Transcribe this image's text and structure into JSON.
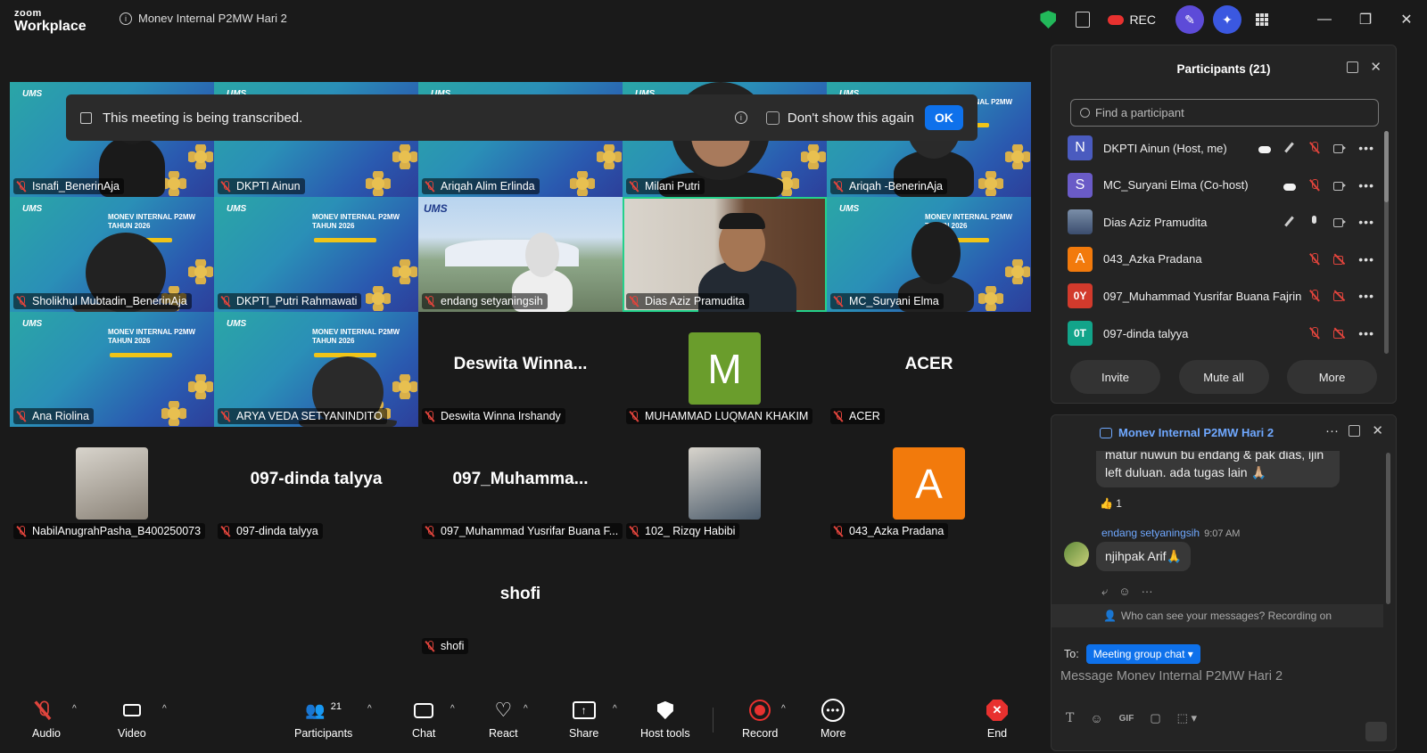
{
  "app": {
    "logo_top": "zoom",
    "logo_bottom": "Workplace",
    "meeting_title": "Monev Internal P2MW Hari 2",
    "rec_label": "REC"
  },
  "banner": {
    "text": "This meeting is being transcribed.",
    "dont_show": "Don't show this again",
    "ok": "OK"
  },
  "tiles": [
    {
      "name": "Isnafi_BenerinAja"
    },
    {
      "name": "DKPTI Ainun"
    },
    {
      "name": "Ariqah Alim Erlinda"
    },
    {
      "name": "Milani Putri"
    },
    {
      "name": "Ariqah -BenerinAja"
    },
    {
      "name": "Sholikhul Mubtadin_BenerinAja"
    },
    {
      "name": "DKPTI_Putri Rahmawati"
    },
    {
      "name": "endang setyaningsih"
    },
    {
      "name": "Dias Aziz Pramudita"
    },
    {
      "name": "MC_Suryani Elma"
    },
    {
      "name": "Ana Riolina"
    },
    {
      "name": "ARYA VEDA SETYANINDITO"
    },
    {
      "name": "Deswita Winna Irshandy",
      "big": "Deswita  Winna..."
    },
    {
      "name": "MUHAMMAD LUQMAN KHAKIM",
      "avatar": "M"
    },
    {
      "name": "ACER",
      "big": "ACER"
    },
    {
      "name": "NabilAnugrahPasha_B400250073"
    },
    {
      "name": "097-dinda talyya",
      "big": "097-dinda talyya"
    },
    {
      "name": "097_Muhammad Yusrifar Buana F...",
      "big": "097_Muhamma..."
    },
    {
      "name": "102_ Rizqy Habibi"
    },
    {
      "name": "043_Azka Pradana",
      "avatar": "A"
    },
    {
      "name": "shofi",
      "big": "shofi"
    }
  ],
  "bg_text": {
    "ums": "UMS",
    "title": "MONEV INTERNAL P2MW",
    "year": "TAHUN 2026",
    "ums_logo": "UMS"
  },
  "participants": {
    "title": "Participants (21)",
    "search_placeholder": "Find a participant",
    "rows": [
      {
        "initial": "N",
        "name": "DKPTI Ainun (Host, me)",
        "color": "#4a5bbf"
      },
      {
        "initial": "S",
        "name": "MC_Suryani Elma (Co-host)",
        "color": "#6a5bc7"
      },
      {
        "initial": "",
        "name": "Dias Aziz Pramudita",
        "color": "#3b4d6e"
      },
      {
        "initial": "A",
        "name": "043_Azka Pradana",
        "color": "#f27a0c"
      },
      {
        "initial": "0Y",
        "name": "097_Muhammad Yusrifar Buana Fajrin",
        "color": "#d23a2c"
      },
      {
        "initial": "0T",
        "name": "097-dinda talyya",
        "color": "#12a48a"
      }
    ],
    "invite": "Invite",
    "mute_all": "Mute all",
    "more": "More"
  },
  "chat": {
    "title": "Monev Internal P2MW Hari 2",
    "msg1": "matur nuwun bu endang & pak dias, ijin left duluan. ada tugas lain 🙏🏼",
    "reaction": "👍 1",
    "sender": "endang setyaningsih",
    "time": "9:07 AM",
    "msg2": "njihpak Arif🙏",
    "who_can_see": "Who can see your messages? Recording on",
    "to_label": "To:",
    "to_value": "Meeting group chat",
    "input_placeholder": "Message Monev Internal P2MW Hari 2",
    "gif": "GIF"
  },
  "toolbar": {
    "audio": "Audio",
    "video": "Video",
    "participants": "Participants",
    "participants_count": "21",
    "chat": "Chat",
    "react": "React",
    "share": "Share",
    "host_tools": "Host tools",
    "record": "Record",
    "more": "More",
    "end": "End"
  }
}
